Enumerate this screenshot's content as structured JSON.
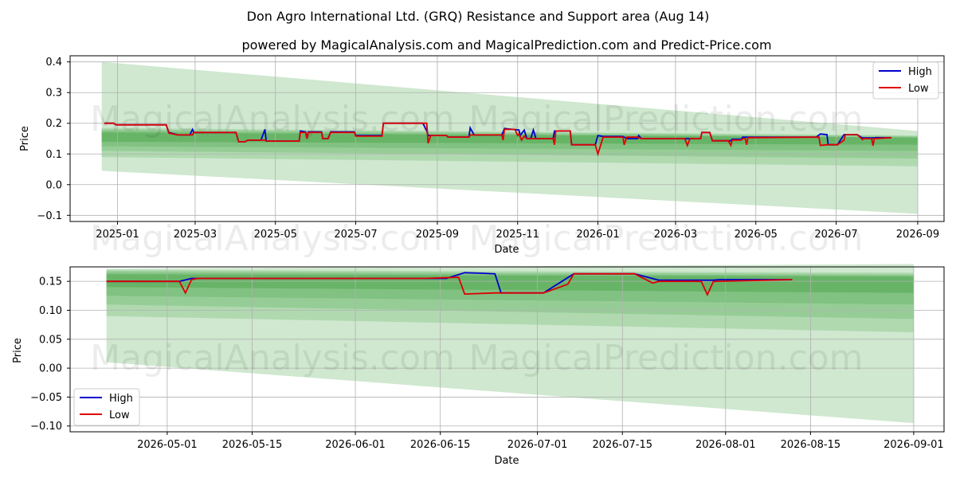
{
  "title": "Don Agro International Ltd. (GRQ) Resistance and Support area (Aug 14)",
  "subtitle": "powered by MagicalAnalysis.com and MagicalPrediction.com and Predict-Price.com",
  "watermarks": [
    "MagicalAnalysis.com",
    "MagicalPrediction.com"
  ],
  "colors": {
    "high": "#0000cc",
    "low": "#dd0000",
    "band": "#2e9a2e"
  },
  "chart_data": [
    {
      "type": "line",
      "xlabel": "Date",
      "ylabel": "Price",
      "x_ticks": [
        "2025-01",
        "2025-03",
        "2025-05",
        "2025-07",
        "2025-09",
        "2025-11",
        "2026-01",
        "2026-03",
        "2026-05",
        "2026-07",
        "2026-09"
      ],
      "y_ticks": [
        "0.4",
        "0.3",
        "0.2",
        "0.1",
        "0.0",
        "−0.1"
      ],
      "ylim": [
        -0.12,
        0.42
      ],
      "legend": {
        "position": "top-right",
        "entries": [
          "High",
          "Low"
        ]
      },
      "grid": true,
      "series": [
        {
          "name": "High",
          "points": [
            [
              "2024-12-22",
              0.2
            ],
            [
              "2024-12-29",
              0.2
            ],
            [
              "2024-12-31",
              0.195
            ],
            [
              "2025-02-07",
              0.195
            ],
            [
              "2025-02-09",
              0.17
            ],
            [
              "2025-02-16",
              0.162
            ],
            [
              "2025-02-25",
              0.162
            ],
            [
              "2025-02-27",
              0.18
            ],
            [
              "2025-02-28",
              0.17
            ],
            [
              "2025-04-01",
              0.17
            ],
            [
              "2025-04-03",
              0.14
            ],
            [
              "2025-04-08",
              0.14
            ],
            [
              "2025-04-10",
              0.145
            ],
            [
              "2025-04-20",
              0.145
            ],
            [
              "2025-04-23",
              0.18
            ],
            [
              "2025-04-24",
              0.142
            ],
            [
              "2025-05-19",
              0.142
            ],
            [
              "2025-05-20",
              0.175
            ],
            [
              "2025-05-24",
              0.172
            ],
            [
              "2025-05-25",
              0.15
            ],
            [
              "2025-05-26",
              0.172
            ],
            [
              "2025-06-05",
              0.172
            ],
            [
              "2025-06-06",
              0.15
            ],
            [
              "2025-06-10",
              0.15
            ],
            [
              "2025-06-12",
              0.172
            ],
            [
              "2025-06-30",
              0.172
            ],
            [
              "2025-07-01",
              0.16
            ],
            [
              "2025-07-21",
              0.16
            ],
            [
              "2025-07-22",
              0.2
            ],
            [
              "2025-08-21",
              0.2
            ],
            [
              "2025-08-24",
              0.175
            ],
            [
              "2025-08-25",
              0.16
            ],
            [
              "2025-09-08",
              0.16
            ],
            [
              "2025-09-09",
              0.155
            ],
            [
              "2025-09-25",
              0.155
            ],
            [
              "2025-09-26",
              0.185
            ],
            [
              "2025-09-29",
              0.162
            ],
            [
              "2025-10-20",
              0.162
            ],
            [
              "2025-10-22",
              0.183
            ],
            [
              "2025-11-02",
              0.178
            ],
            [
              "2025-11-03",
              0.16
            ],
            [
              "2025-11-06",
              0.178
            ],
            [
              "2025-11-08",
              0.15
            ],
            [
              "2025-11-11",
              0.15
            ],
            [
              "2025-11-13",
              0.178
            ],
            [
              "2025-11-15",
              0.15
            ],
            [
              "2025-11-28",
              0.15
            ],
            [
              "2025-11-29",
              0.175
            ],
            [
              "2025-12-11",
              0.175
            ],
            [
              "2025-12-12",
              0.13
            ],
            [
              "2025-12-30",
              0.13
            ],
            [
              "2026-01-01",
              0.16
            ],
            [
              "2026-01-05",
              0.157
            ],
            [
              "2026-01-20",
              0.157
            ],
            [
              "2026-01-23",
              0.15
            ],
            [
              "2026-01-31",
              0.15
            ],
            [
              "2026-02-01",
              0.16
            ],
            [
              "2026-02-03",
              0.15
            ],
            [
              "2026-03-08",
              0.15
            ],
            [
              "2026-03-10",
              0.15
            ],
            [
              "2026-03-20",
              0.15
            ],
            [
              "2026-03-21",
              0.17
            ],
            [
              "2026-03-27",
              0.17
            ],
            [
              "2026-03-29",
              0.143
            ],
            [
              "2026-04-12",
              0.143
            ],
            [
              "2026-04-13",
              0.148
            ],
            [
              "2026-04-20",
              0.148
            ],
            [
              "2026-04-21",
              0.155
            ],
            [
              "2026-06-16",
              0.155
            ],
            [
              "2026-06-19",
              0.165
            ],
            [
              "2026-06-24",
              0.163
            ],
            [
              "2026-06-25",
              0.13
            ],
            [
              "2026-07-02",
              0.13
            ],
            [
              "2026-07-07",
              0.163
            ],
            [
              "2026-07-17",
              0.163
            ],
            [
              "2026-07-21",
              0.152
            ],
            [
              "2026-07-30",
              0.152
            ],
            [
              "2026-07-31",
              0.153
            ],
            [
              "2026-08-12",
              0.153
            ]
          ]
        },
        {
          "name": "Low",
          "points": [
            [
              "2024-12-22",
              0.2
            ],
            [
              "2024-12-29",
              0.2
            ],
            [
              "2024-12-31",
              0.195
            ],
            [
              "2025-02-07",
              0.195
            ],
            [
              "2025-02-09",
              0.168
            ],
            [
              "2025-02-16",
              0.162
            ],
            [
              "2025-02-27",
              0.162
            ],
            [
              "2025-02-28",
              0.17
            ],
            [
              "2025-04-01",
              0.17
            ],
            [
              "2025-04-03",
              0.14
            ],
            [
              "2025-04-08",
              0.14
            ],
            [
              "2025-04-10",
              0.145
            ],
            [
              "2025-04-23",
              0.145
            ],
            [
              "2025-04-25",
              0.142
            ],
            [
              "2025-05-19",
              0.142
            ],
            [
              "2025-05-20",
              0.17
            ],
            [
              "2025-05-24",
              0.17
            ],
            [
              "2025-05-25",
              0.15
            ],
            [
              "2025-05-26",
              0.17
            ],
            [
              "2025-06-05",
              0.17
            ],
            [
              "2025-06-06",
              0.15
            ],
            [
              "2025-06-10",
              0.15
            ],
            [
              "2025-06-12",
              0.17
            ],
            [
              "2025-06-30",
              0.17
            ],
            [
              "2025-07-01",
              0.158
            ],
            [
              "2025-07-21",
              0.158
            ],
            [
              "2025-07-22",
              0.2
            ],
            [
              "2025-08-24",
              0.2
            ],
            [
              "2025-08-25",
              0.135
            ],
            [
              "2025-08-27",
              0.16
            ],
            [
              "2025-09-08",
              0.16
            ],
            [
              "2025-09-09",
              0.155
            ],
            [
              "2025-09-25",
              0.155
            ],
            [
              "2025-09-26",
              0.162
            ],
            [
              "2025-10-20",
              0.162
            ],
            [
              "2025-10-21",
              0.145
            ],
            [
              "2025-10-22",
              0.18
            ],
            [
              "2025-10-30",
              0.18
            ],
            [
              "2025-11-01",
              0.16
            ],
            [
              "2025-11-02",
              0.165
            ],
            [
              "2025-11-04",
              0.145
            ],
            [
              "2025-11-06",
              0.158
            ],
            [
              "2025-11-08",
              0.15
            ],
            [
              "2025-11-11",
              0.15
            ],
            [
              "2025-11-28",
              0.15
            ],
            [
              "2025-11-29",
              0.13
            ],
            [
              "2025-11-30",
              0.175
            ],
            [
              "2025-12-11",
              0.175
            ],
            [
              "2025-12-12",
              0.13
            ],
            [
              "2025-12-30",
              0.13
            ],
            [
              "2026-01-01",
              0.1
            ],
            [
              "2026-01-05",
              0.155
            ],
            [
              "2026-01-20",
              0.155
            ],
            [
              "2026-01-21",
              0.13
            ],
            [
              "2026-01-23",
              0.155
            ],
            [
              "2026-01-31",
              0.155
            ],
            [
              "2026-02-03",
              0.15
            ],
            [
              "2026-03-08",
              0.15
            ],
            [
              "2026-03-10",
              0.128
            ],
            [
              "2026-03-12",
              0.15
            ],
            [
              "2026-03-20",
              0.15
            ],
            [
              "2026-03-21",
              0.17
            ],
            [
              "2026-03-27",
              0.17
            ],
            [
              "2026-03-29",
              0.143
            ],
            [
              "2026-04-10",
              0.143
            ],
            [
              "2026-04-12",
              0.128
            ],
            [
              "2026-04-13",
              0.145
            ],
            [
              "2026-04-20",
              0.145
            ],
            [
              "2026-04-21",
              0.15
            ],
            [
              "2026-04-23",
              0.15
            ],
            [
              "2026-04-24",
              0.13
            ],
            [
              "2026-04-25",
              0.153
            ],
            [
              "2026-06-18",
              0.155
            ],
            [
              "2026-06-19",
              0.128
            ],
            [
              "2026-06-24",
              0.13
            ],
            [
              "2026-07-02",
              0.13
            ],
            [
              "2026-07-07",
              0.145
            ],
            [
              "2026-07-08",
              0.163
            ],
            [
              "2026-07-17",
              0.163
            ],
            [
              "2026-07-21",
              0.147
            ],
            [
              "2026-07-22",
              0.15
            ],
            [
              "2026-07-27",
              0.15
            ],
            [
              "2026-07-28",
              0.15
            ],
            [
              "2026-07-29",
              0.127
            ],
            [
              "2026-07-30",
              0.15
            ],
            [
              "2026-08-12",
              0.153
            ]
          ]
        }
      ],
      "bands": [
        {
          "x": [
            "2024-12-20",
            "2026-09-01"
          ],
          "upper": [
            0.4,
            0.175
          ],
          "lower": [
            0.045,
            -0.095
          ]
        },
        {
          "x": [
            "2024-12-20",
            "2026-09-01"
          ],
          "upper": [
            0.185,
            0.16
          ],
          "lower": [
            0.09,
            0.06
          ]
        },
        {
          "x": [
            "2024-12-20",
            "2026-09-01"
          ],
          "upper": [
            0.18,
            0.158
          ],
          "lower": [
            0.11,
            0.085
          ]
        },
        {
          "x": [
            "2024-12-20",
            "2026-09-01"
          ],
          "upper": [
            0.175,
            0.155
          ],
          "lower": [
            0.125,
            0.11
          ]
        },
        {
          "x": [
            "2024-12-20",
            "2026-09-01"
          ],
          "upper": [
            0.17,
            0.153
          ],
          "lower": [
            0.14,
            0.13
          ]
        }
      ]
    },
    {
      "type": "line",
      "xlabel": "Date",
      "ylabel": "Price",
      "x_ticks": [
        "2026-05-01",
        "2026-05-15",
        "2026-06-01",
        "2026-06-15",
        "2026-07-01",
        "2026-07-15",
        "2026-08-01",
        "2026-08-15",
        "2026-09-01"
      ],
      "y_ticks": [
        "0.15",
        "0.10",
        "0.05",
        "0.00",
        "−0.05",
        "−0.10"
      ],
      "ylim": [
        -0.11,
        0.175
      ],
      "legend": {
        "position": "bottom-left",
        "entries": [
          "High",
          "Low"
        ]
      },
      "grid": true,
      "series": [
        {
          "name": "High",
          "points": [
            [
              "2026-04-21",
              0.15
            ],
            [
              "2026-05-03",
              0.15
            ],
            [
              "2026-05-05",
              0.155
            ],
            [
              "2026-06-16",
              0.155
            ],
            [
              "2026-06-19",
              0.165
            ],
            [
              "2026-06-22",
              0.164
            ],
            [
              "2026-06-24",
              0.163
            ],
            [
              "2026-06-25",
              0.13
            ],
            [
              "2026-07-02",
              0.13
            ],
            [
              "2026-07-07",
              0.163
            ],
            [
              "2026-07-17",
              0.163
            ],
            [
              "2026-07-21",
              0.152
            ],
            [
              "2026-07-30",
              0.152
            ],
            [
              "2026-07-31",
              0.153
            ],
            [
              "2026-08-12",
              0.153
            ]
          ]
        },
        {
          "name": "Low",
          "points": [
            [
              "2026-04-21",
              0.15
            ],
            [
              "2026-05-03",
              0.15
            ],
            [
              "2026-05-04",
              0.13
            ],
            [
              "2026-05-05",
              0.153
            ],
            [
              "2026-05-06",
              0.155
            ],
            [
              "2026-06-12",
              0.155
            ],
            [
              "2026-06-18",
              0.157
            ],
            [
              "2026-06-19",
              0.128
            ],
            [
              "2026-06-24",
              0.13
            ],
            [
              "2026-07-02",
              0.13
            ],
            [
              "2026-07-06",
              0.145
            ],
            [
              "2026-07-07",
              0.163
            ],
            [
              "2026-07-17",
              0.163
            ],
            [
              "2026-07-20",
              0.147
            ],
            [
              "2026-07-21",
              0.15
            ],
            [
              "2026-07-27",
              0.15
            ],
            [
              "2026-07-28",
              0.15
            ],
            [
              "2026-07-29",
              0.127
            ],
            [
              "2026-07-30",
              0.15
            ],
            [
              "2026-08-12",
              0.153
            ]
          ]
        }
      ],
      "bands": [
        {
          "x": [
            "2026-04-21",
            "2026-09-01"
          ],
          "upper": [
            0.172,
            0.18
          ],
          "lower": [
            0.01,
            -0.095
          ]
        },
        {
          "x": [
            "2026-04-21",
            "2026-09-01"
          ],
          "upper": [
            0.17,
            0.165
          ],
          "lower": [
            0.09,
            0.062
          ]
        },
        {
          "x": [
            "2026-04-21",
            "2026-09-01"
          ],
          "upper": [
            0.168,
            0.162
          ],
          "lower": [
            0.11,
            0.085
          ]
        },
        {
          "x": [
            "2026-04-21",
            "2026-09-01"
          ],
          "upper": [
            0.165,
            0.16
          ],
          "lower": [
            0.125,
            0.11
          ]
        },
        {
          "x": [
            "2026-04-21",
            "2026-09-01"
          ],
          "upper": [
            0.162,
            0.158
          ],
          "lower": [
            0.14,
            0.13
          ]
        }
      ]
    }
  ]
}
